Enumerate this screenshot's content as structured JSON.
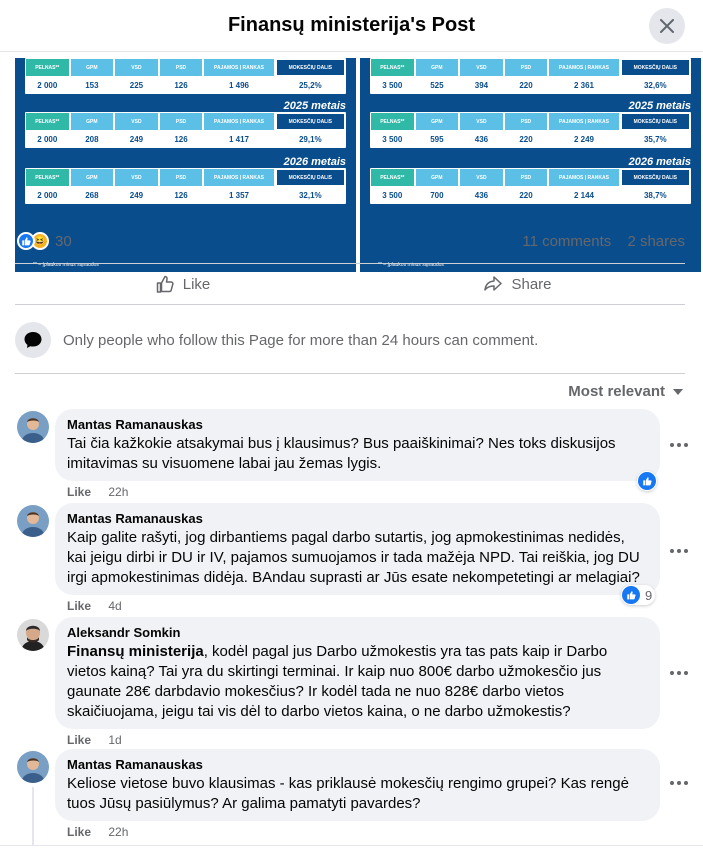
{
  "header": {
    "title": "Finansų ministerija's Post"
  },
  "image_left": {
    "header_cells": [
      "PELNAS**",
      "GPM",
      "VSD",
      "PSD",
      "PAJAMOS Į RANKAS",
      "MOKESČIŲ DALIS"
    ],
    "rows": [
      {
        "year": "",
        "values": [
          "2 000",
          "153",
          "225",
          "126",
          "1 496",
          "25,2%"
        ]
      },
      {
        "year": "2025 metais",
        "values": [
          "2 000",
          "208",
          "249",
          "126",
          "1 417",
          "29,1%"
        ]
      },
      {
        "year": "2026 metais",
        "values": [
          "2 000",
          "268",
          "249",
          "126",
          "1 357",
          "32,1%"
        ]
      }
    ],
    "note": "** – Įplaukos minus sąnaudos"
  },
  "image_right": {
    "header_cells": [
      "PELNAS**",
      "GPM",
      "VSD",
      "PSD",
      "PAJAMOS Į RANKAS",
      "MOKESČIŲ DALIS"
    ],
    "rows": [
      {
        "year": "",
        "values": [
          "3 500",
          "525",
          "394",
          "220",
          "2 361",
          "32,6%"
        ]
      },
      {
        "year": "2025 metais",
        "values": [
          "3 500",
          "595",
          "436",
          "220",
          "2 249",
          "35,7%"
        ]
      },
      {
        "year": "2026 metais",
        "values": [
          "3 500",
          "700",
          "436",
          "220",
          "2 144",
          "38,7%"
        ]
      }
    ],
    "note": "** – Įplaukos minus sąnaudos"
  },
  "stats": {
    "reaction_count": "30",
    "comments": "11 comments",
    "shares": "2 shares"
  },
  "actions": {
    "like": "Like",
    "share": "Share"
  },
  "restriction": "Only people who follow this Page for more than 24 hours can comment.",
  "sort_label": "Most relevant",
  "comments": [
    {
      "author": "Mantas Ramanauskas",
      "text": "Tai čia kažkokie atsakymai bus į klausimus? Bus paaiškinimai? Nes toks diskusijos imitavimas su visuomene labai jau žemas lygis.",
      "like": "Like",
      "time": "22h",
      "reaction_count": ""
    },
    {
      "author": "Mantas Ramanauskas",
      "text": "Kaip galite rašyti, jog dirbantiems pagal darbo sutartis, jog apmokestinimas nedidės, kai jeigu dirbi ir DU ir IV, pajamos sumuojamos ir tada mažėja NPD. Tai reiškia, jog DU irgi apmokestinimas didėja. BAndau suprasti ar Jūs esate nekompetetingi ar melagiai?",
      "like": "Like",
      "time": "4d",
      "reaction_count": "9"
    },
    {
      "author": "Aleksandr Somkin",
      "mention": "Finansų ministerija",
      "text": ", kodėl pagal jus Darbo užmokestis yra tas pats kaip ir Darbo vietos kainą? Tai yra du skirtingi terminai. Ir kaip nuo 800€ darbo užmokesčio jus gaunate 28€ darbdavio mokesčius? Ir kodėl tada ne nuo 828€ darbo vietos skaičiuojama, jeigu tai vis dėl to darbo vietos kaina, o ne darbo užmokestis?",
      "like": "Like",
      "time": "1d",
      "reaction_count": ""
    },
    {
      "author": "Mantas Ramanauskas",
      "text": "Keliose vietose buvo klausimas - kas priklausė mokesčių rengimo grupei? Kas rengė tuos Jūsų pasiūlymus? Ar galima pamatyti pavardes?",
      "like": "Like",
      "time": "22h",
      "reaction_count": ""
    }
  ],
  "colors": {
    "accent": "#1877f2",
    "panel_blue": "#0a4d8c",
    "muted": "#65676b",
    "bubble": "#f0f2f5"
  }
}
